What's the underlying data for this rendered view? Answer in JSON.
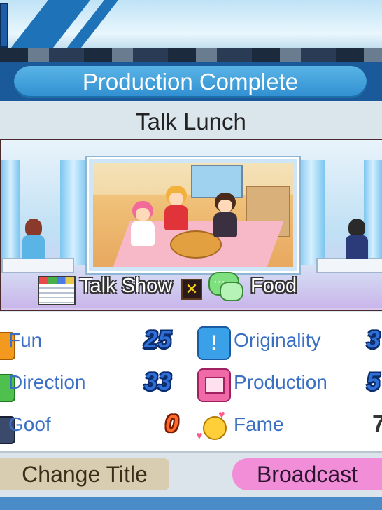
{
  "header": {
    "title": "Production Complete"
  },
  "show": {
    "title": "Talk Lunch",
    "genre": "Talk Show",
    "subject": "Food"
  },
  "stats": {
    "fun": {
      "label": "Fun",
      "value": "25"
    },
    "direction": {
      "label": "Direction",
      "value": "33"
    },
    "goof": {
      "label": "Goof",
      "value": "0"
    },
    "originality": {
      "label": "Originality",
      "value": "3"
    },
    "production": {
      "label": "Production",
      "value": "5"
    },
    "fame": {
      "label": "Fame",
      "value": "7"
    }
  },
  "actions": {
    "change_title": "Change Title",
    "broadcast": "Broadcast"
  },
  "icons": {
    "genre": "schedule-calendar-icon",
    "combo": "x-combo-icon",
    "subject": "speech-bubble-icon",
    "fun": "fun-icon",
    "direction": "direction-icon",
    "goof": "goof-icon",
    "originality": "exclamation-icon",
    "production": "tv-screen-icon",
    "fame": "smiley-hearts-icon"
  },
  "colors": {
    "title_pill": "#2f8ed0",
    "stat_text": "#3a6fc4",
    "broadcast_button": "#f28ed8",
    "change_title_button": "#d8cdb0"
  }
}
